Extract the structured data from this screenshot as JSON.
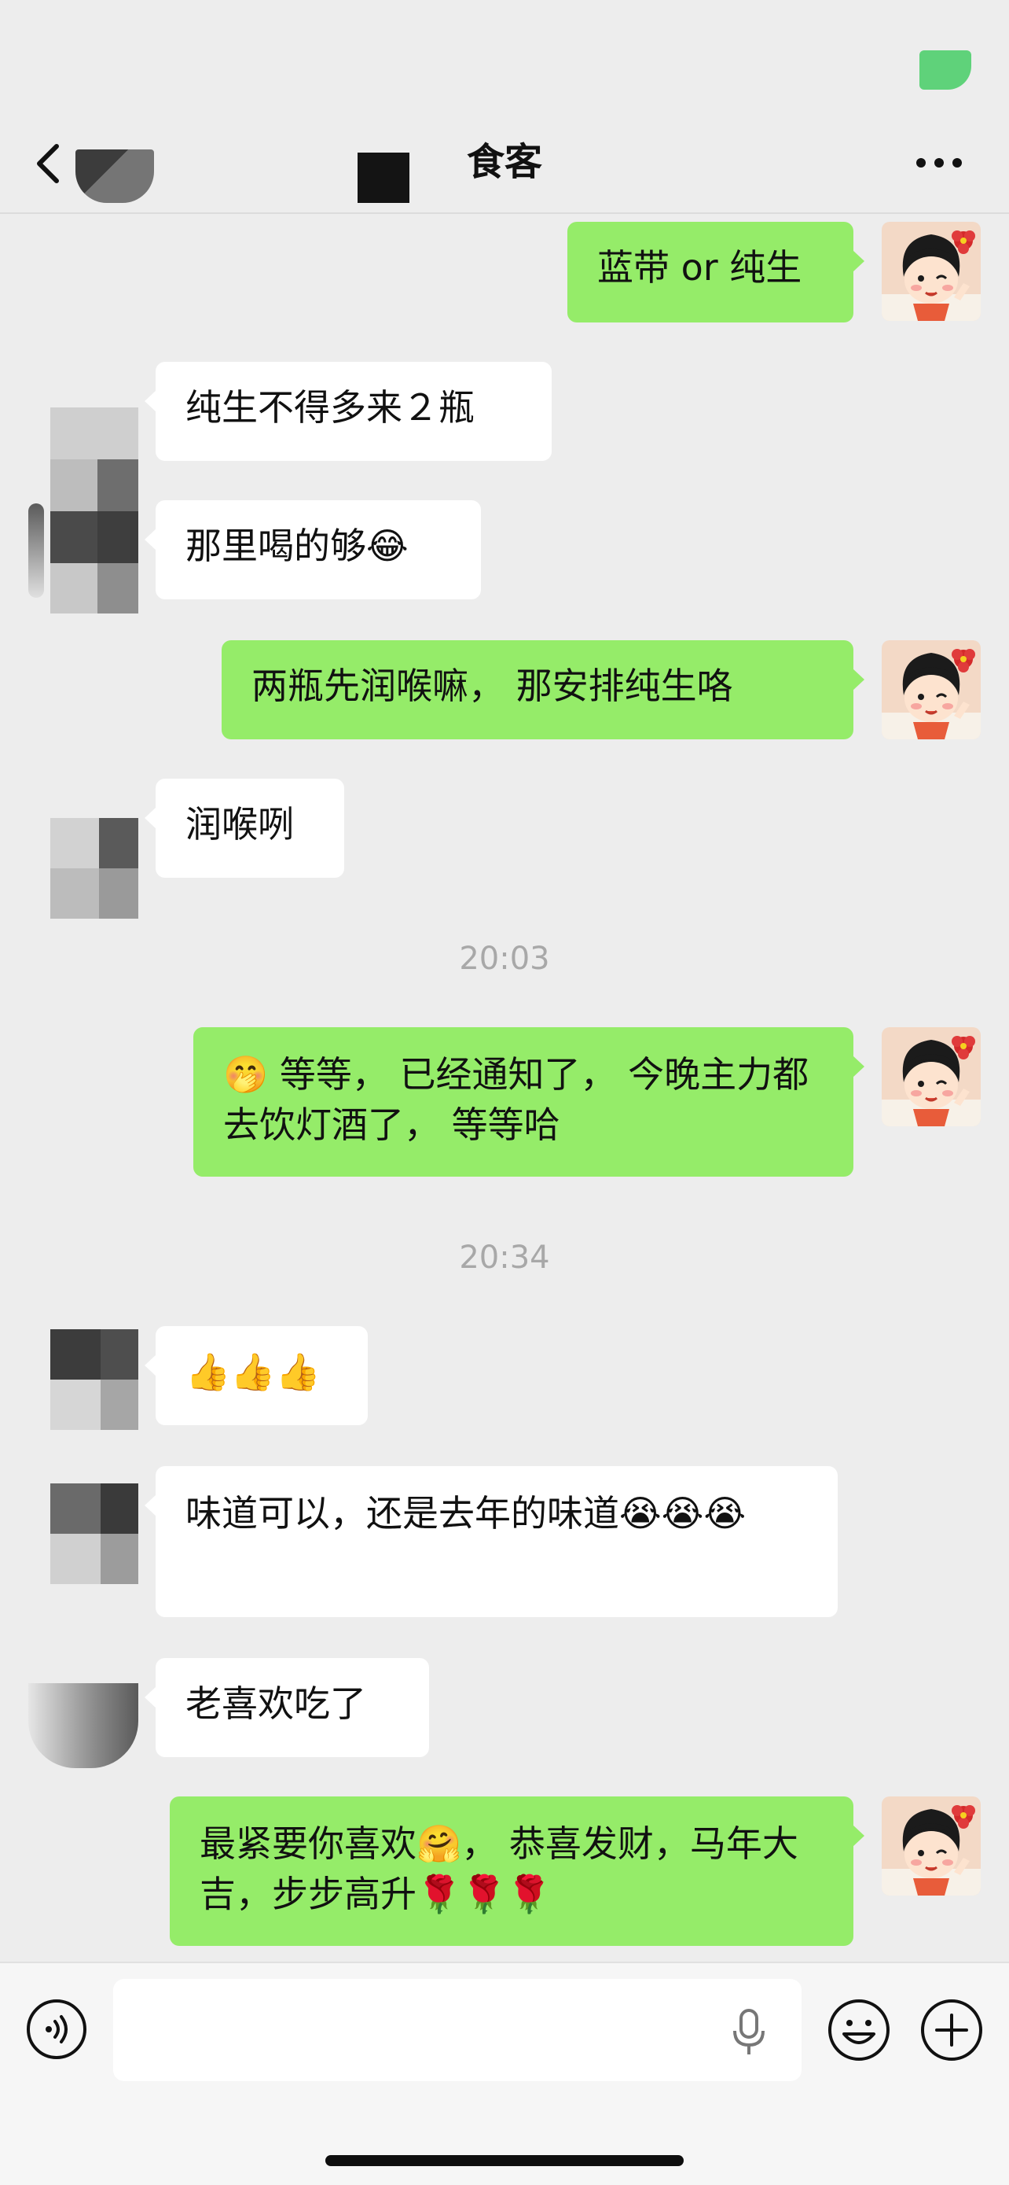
{
  "header": {
    "title": "食客",
    "back_icon": "chevron-left-icon",
    "more_icon": "ellipsis-icon"
  },
  "messages": [
    {
      "side": "out",
      "text": "蓝带 or 纯生"
    },
    {
      "side": "in",
      "text": "纯生不得多来２瓶"
    },
    {
      "side": "in",
      "text": "那里喝的够😂"
    },
    {
      "side": "out",
      "text": "两瓶先润喉嘛， 那安排纯生咯"
    },
    {
      "side": "in",
      "text": "润喉咧"
    },
    {
      "side": "time",
      "text": "20:03"
    },
    {
      "side": "out",
      "text": "🤭 等等， 已经通知了， 今晚主力都去饮灯酒了， 等等哈"
    },
    {
      "side": "time",
      "text": "20:34"
    },
    {
      "side": "in",
      "text": "👍👍👍"
    },
    {
      "side": "in",
      "text": "味道可以，还是去年的味道😭😭😭"
    },
    {
      "side": "in",
      "text": "老喜欢吃了"
    },
    {
      "side": "out",
      "text": "最紧要你喜欢🤗， 恭喜发财，马年大吉，步步高升🌹🌹🌹"
    }
  ],
  "input_bar": {
    "voice_icon": "voice-toggle-icon",
    "mic_icon": "microphone-icon",
    "emoji_icon": "emoji-icon",
    "plus_icon": "plus-icon"
  },
  "colors": {
    "background": "#ededed",
    "outgoing_bubble": "#95ec69",
    "incoming_bubble": "#ffffff",
    "timestamp": "#a8a8a8"
  }
}
